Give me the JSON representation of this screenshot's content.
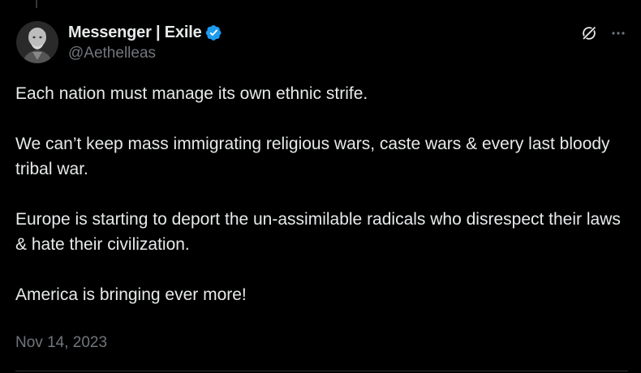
{
  "author": {
    "display_name": "Messenger | Exile",
    "handle": "@Aethelleas",
    "verified": true,
    "verified_color": "#1d9bf0"
  },
  "actions": {
    "grok_icon": "grok-slash-icon",
    "more_icon": "more-dots-icon"
  },
  "tweet": {
    "paragraphs": [
      "Each nation must manage its own ethnic strife.",
      "We can’t keep mass immigrating religious wars, caste wars & every last bloody tribal war.",
      "Europe is starting to deport the un-assimilable radicals who disrespect their laws & hate their civilization.",
      "America is bringing ever more!"
    ],
    "date": "Nov 14, 2023"
  },
  "colors": {
    "background": "#000000",
    "text_primary": "#e7e9ea",
    "text_secondary": "#71767b",
    "divider": "#2f3336"
  }
}
